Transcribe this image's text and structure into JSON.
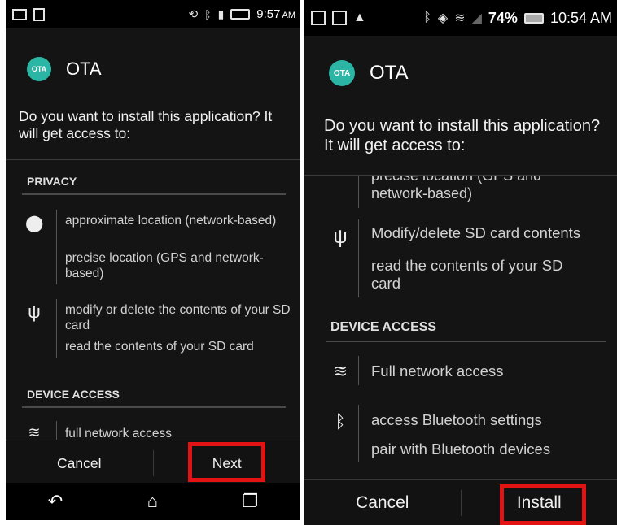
{
  "left": {
    "status": {
      "time": "9:57",
      "ampm": "AM"
    },
    "app": {
      "icon_text": "OTA",
      "title": "OTA"
    },
    "question": "Do you want to install this application? It will get access to:",
    "sections": {
      "privacy": "PRIVACY",
      "device_access": "DEVICE ACCESS"
    },
    "permissions": {
      "approx_location": "approximate location (network-based)",
      "precise_location": "precise location (GPS and network-based)",
      "modify_sd": "modify or delete the contents of your SD card",
      "read_sd": "read the contents of your SD card",
      "network": "full network access"
    },
    "buttons": {
      "cancel": "Cancel",
      "next": "Next"
    }
  },
  "right": {
    "status": {
      "battery": "74%",
      "time": "10:54 AM"
    },
    "app": {
      "icon_text": "OTA",
      "title": "OTA"
    },
    "question": "Do you want to install this application? It will get access to:",
    "partial_text": "precise location (GPS and network-based)",
    "permissions": {
      "modify_sd": "Modify/delete SD card contents",
      "read_sd": "read the contents of your SD card",
      "network": "Full network access",
      "bt_settings": "access Bluetooth settings",
      "bt_pair": "pair with Bluetooth devices"
    },
    "sections": {
      "device_access": "DEVICE ACCESS"
    },
    "buttons": {
      "cancel": "Cancel",
      "install": "Install"
    }
  },
  "colors": {
    "highlight": "#e31313",
    "ota_icon": "#2bb5a5"
  }
}
